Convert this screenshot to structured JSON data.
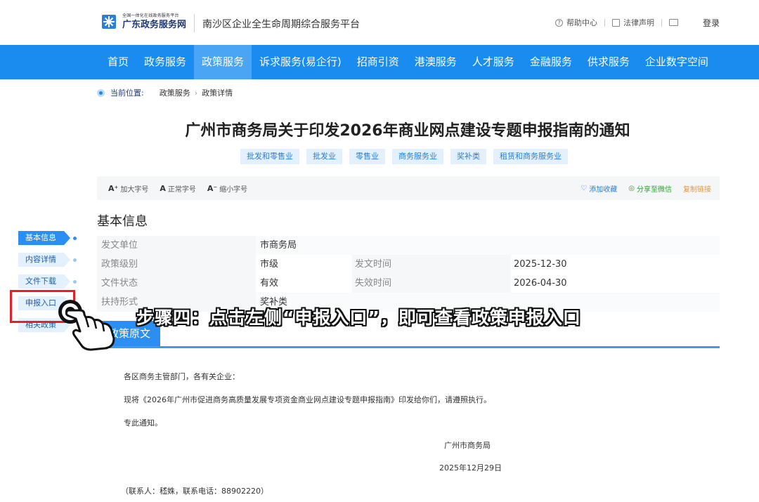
{
  "header": {
    "logo_small": "全国一体化在线政务服务平台",
    "logo_big": "广东政务服务网",
    "site_title": "南沙区企业全生命周期综合服务平台",
    "help": "帮助中心",
    "legal": "法律声明",
    "login": "登录"
  },
  "nav": {
    "items": [
      "首页",
      "政务服务",
      "政策服务",
      "诉求服务(易企行)",
      "招商引资",
      "港澳服务",
      "人才服务",
      "金融服务",
      "供求服务",
      "企业数字空间"
    ],
    "active_index": 2
  },
  "breadcrumb": {
    "label": "当前位置:",
    "items": [
      "政策服务",
      "政策详情"
    ]
  },
  "article": {
    "title": "广州市商务局关于印发2026年商业网点建设专题申报指南的通知",
    "tags": [
      "批发和零售业",
      "批发业",
      "零售业",
      "商务服务业",
      "奖补类",
      "租赁和商务服务业"
    ]
  },
  "toolbar": {
    "font_larger": "加大字号",
    "font_normal": "正常字号",
    "font_smaller": "缩小字号",
    "favorite": "添加收藏",
    "share_wechat": "分享至微信",
    "copy_link": "复制链接"
  },
  "basic_info": {
    "title": "基本信息",
    "issuer_label": "发文单位",
    "issuer": "市商务局",
    "level_label": "政策级别",
    "level": "市级",
    "issue_date_label": "发文时间",
    "issue_date": "2025-12-30",
    "status_label": "文件状态",
    "status": "有效",
    "expiry_label": "失效时间",
    "expiry": "2026-04-30",
    "support_label": "扶持形式",
    "support": "奖补类"
  },
  "original": {
    "tab": "政策原文",
    "salutation": "各区商务主管部门，各有关企业：",
    "body": "现将《2026年广州市促进商务高质量发展专项资金商业网点建设专题申报指南》印发给你们，请遵照执行。",
    "closing": "专此通知。",
    "signature": "广州市商务局",
    "date": "2025年12月29日",
    "contact": "（联系人：嵇姝，联系电话：88902220）"
  },
  "side_nav": {
    "items": [
      "基本信息",
      "内容详情",
      "文件下载",
      "申报入口",
      "相关政策"
    ],
    "active_index": 0
  },
  "overlay": {
    "caption": "步骤四：点击左侧“申报入口”，即可查看政策申报入口"
  },
  "colors": {
    "brand_blue": "#1a8cf0",
    "highlight_red": "#e0232b"
  }
}
